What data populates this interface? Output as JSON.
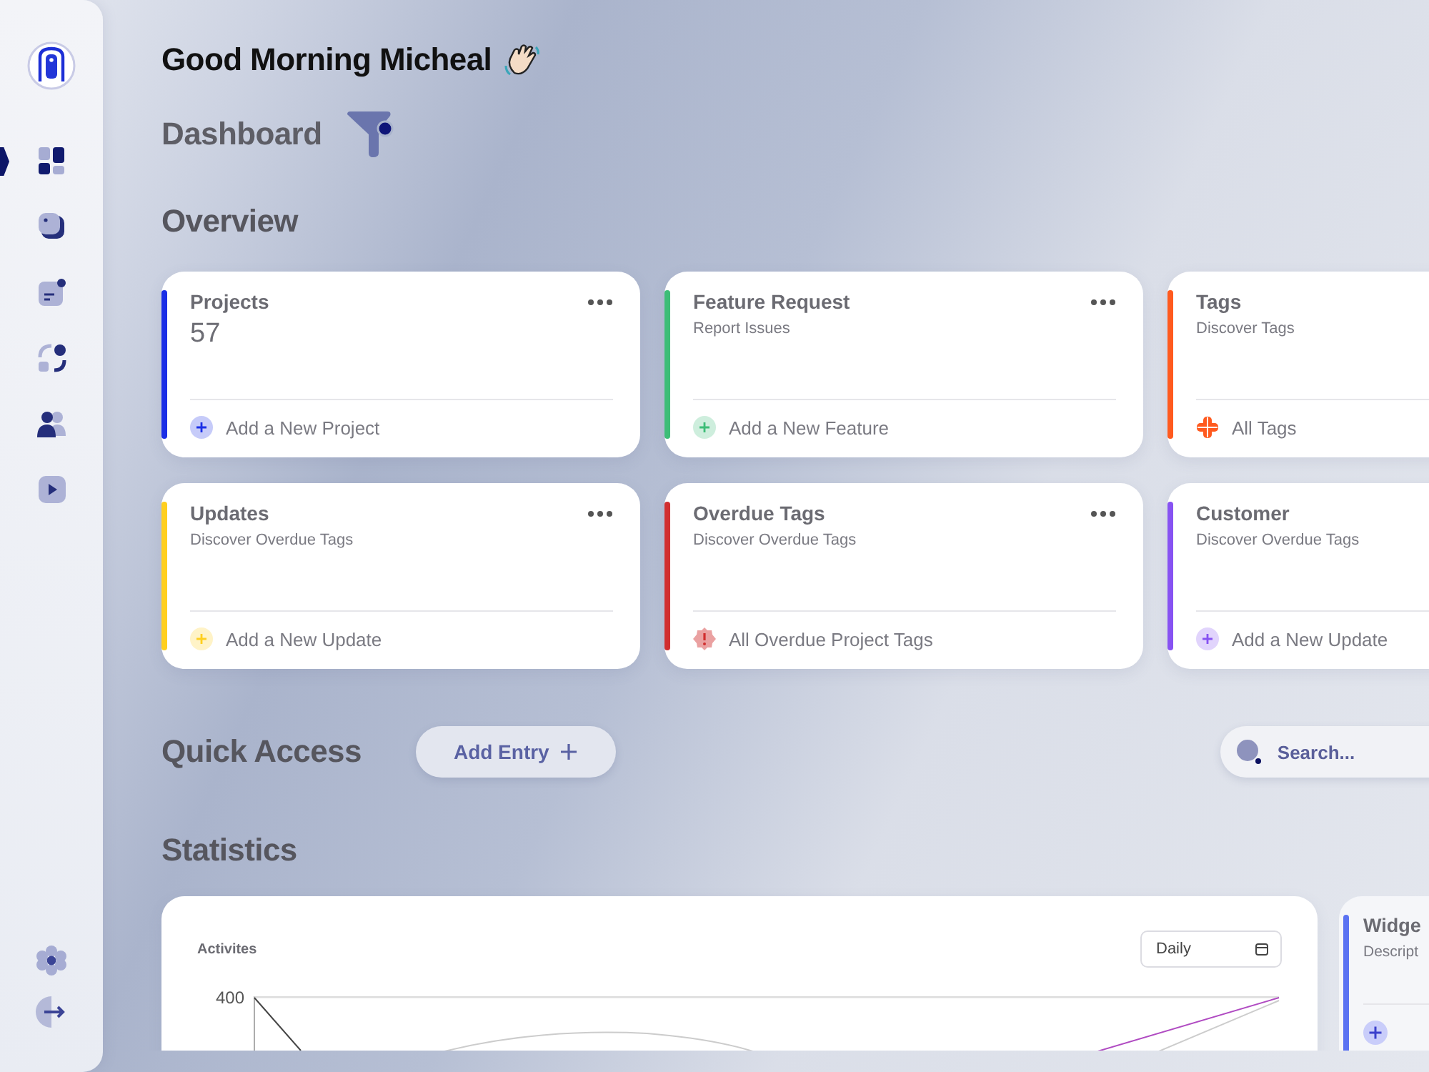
{
  "sidebar": {
    "nav": [
      {
        "selected": true
      },
      {
        "selected": false
      },
      {
        "selected": false
      },
      {
        "selected": false
      },
      {
        "selected": false
      },
      {
        "selected": false
      }
    ]
  },
  "greeting": "Good Morning Micheal",
  "page_title": "Dashboard",
  "overview": {
    "title": "Overview",
    "cards": [
      {
        "title": "Projects",
        "value": "57",
        "color": "#1a2ee6",
        "menu": true,
        "action": {
          "kind": "add",
          "label": "Add a New Project"
        }
      },
      {
        "title": "Feature Request",
        "subtitle": "Report Issues",
        "color": "#3dbd77",
        "menu": true,
        "action": {
          "kind": "add",
          "label": "Add a New Feature"
        }
      },
      {
        "title": "Tags",
        "subtitle": "Discover Tags",
        "color": "#ff5a1f",
        "menu": false,
        "action": {
          "kind": "tags",
          "label": "All Tags"
        }
      },
      {
        "title": "Updates",
        "subtitle": "Discover Overdue Tags",
        "color": "#ffcf1f",
        "menu": true,
        "action": {
          "kind": "add",
          "label": "Add a New Update"
        }
      },
      {
        "title": "Overdue Tags",
        "subtitle": "Discover Overdue Tags",
        "color": "#d12f2f",
        "menu": true,
        "action": {
          "kind": "alert",
          "label": "All Overdue Project Tags"
        }
      },
      {
        "title": "Customer",
        "subtitle": "Discover Overdue Tags",
        "color": "#8752f2",
        "menu": false,
        "action": {
          "kind": "add",
          "label": "Add a New Update"
        }
      }
    ]
  },
  "quick_access": {
    "title": "Quick Access",
    "add_button": "Add Entry",
    "search": {
      "placeholder": "Search..."
    }
  },
  "statistics": {
    "title": "Statistics",
    "activity": {
      "title": "Activites",
      "range": "Daily",
      "y_tick": "400"
    },
    "widget": {
      "title": "Widge",
      "subtitle": "Descript",
      "color": "#5b73f2"
    }
  }
}
